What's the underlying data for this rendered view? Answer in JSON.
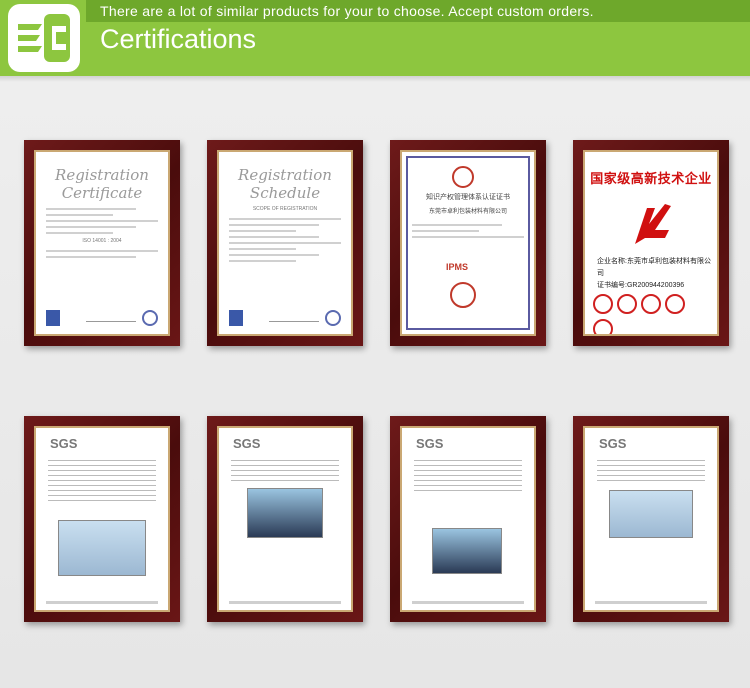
{
  "banner": {
    "tagline": "There are a lot of similar products for your to choose. Accept custom orders.",
    "title": "Certifications",
    "colors": {
      "primary": "#8dc63f",
      "dark": "#6ea82b"
    }
  },
  "certificates": [
    {
      "title_line1": "Registration",
      "title_line2": "Certificate",
      "code": "ISO 14001 : 2004"
    },
    {
      "title_line1": "Registration",
      "title_line2": "Schedule",
      "code": "SCOPE OF REGISTRATION"
    },
    {
      "heading": "知识产权管理体系认证证书",
      "org": "东莞市卓利包装材料有限公司",
      "mark": "IPMS"
    },
    {
      "heading": "国家级高新技术企业",
      "company": "企业名称:东莞市卓利包装材料有限公司",
      "cert_no": "证书编号:GR200944200396"
    },
    {
      "brand": "SGS"
    },
    {
      "brand": "SGS"
    },
    {
      "brand": "SGS"
    },
    {
      "brand": "SGS"
    }
  ]
}
